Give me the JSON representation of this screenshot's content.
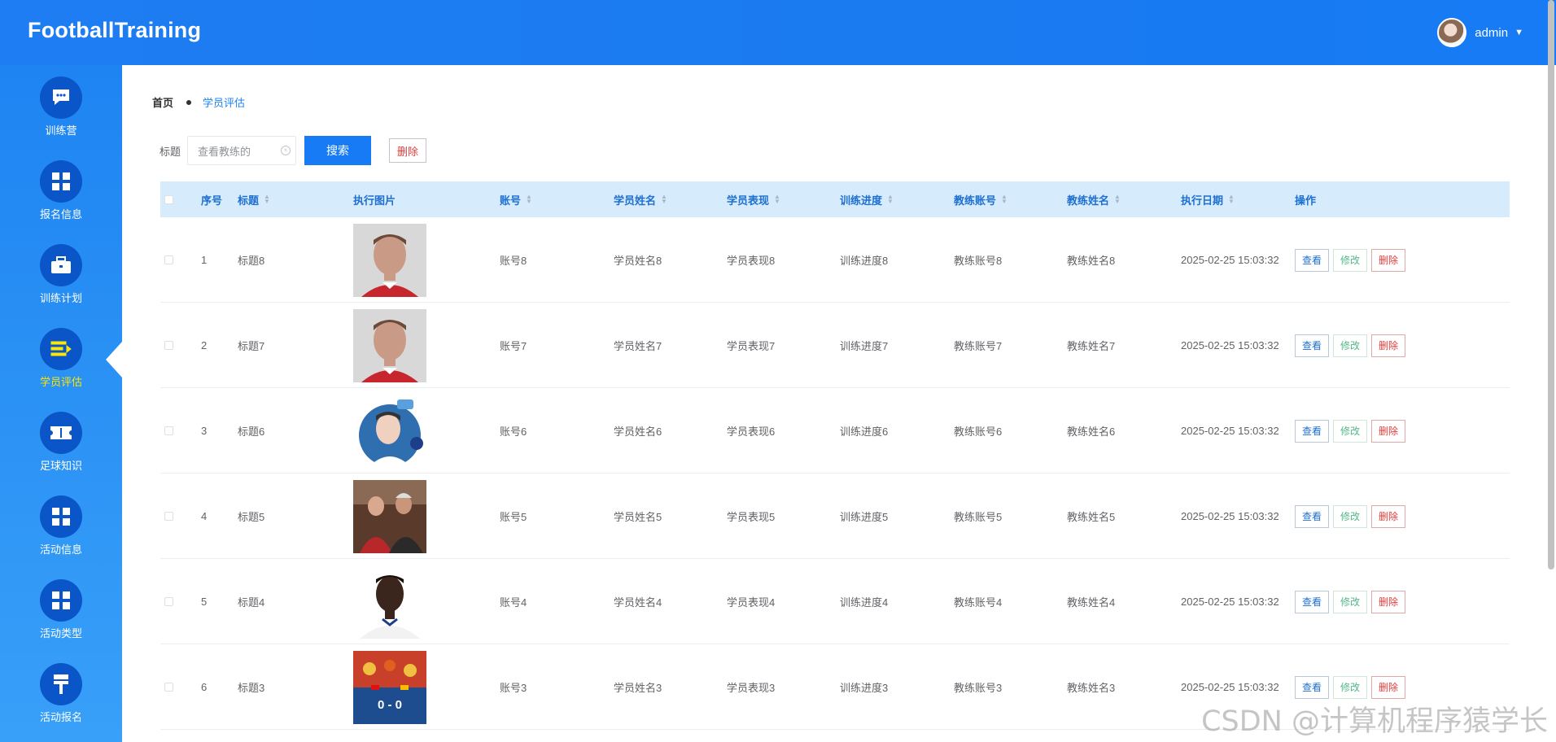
{
  "header": {
    "brand": "FootballTraining",
    "user": "admin"
  },
  "sidebar": {
    "items": [
      {
        "label": "训练营",
        "icon": "chat-icon"
      },
      {
        "label": "报名信息",
        "icon": "grid-icon"
      },
      {
        "label": "训练计划",
        "icon": "briefcase-icon"
      },
      {
        "label": "学员评估",
        "icon": "list-icon",
        "active": true
      },
      {
        "label": "足球知识",
        "icon": "ticket-icon"
      },
      {
        "label": "活动信息",
        "icon": "grid-icon"
      },
      {
        "label": "活动类型",
        "icon": "grid-icon"
      },
      {
        "label": "活动报名",
        "icon": "pin-icon"
      }
    ]
  },
  "breadcrumb": {
    "home": "首页",
    "current": "学员评估"
  },
  "search": {
    "label": "标题",
    "placeholder": "查看教练的",
    "search_button": "搜索",
    "delete_button": "删除"
  },
  "table": {
    "headers": [
      "序号",
      "标题",
      "执行图片",
      "账号",
      "学员姓名",
      "学员表现",
      "训练进度",
      "教练账号",
      "教练姓名",
      "执行日期",
      "操作"
    ],
    "rows": [
      {
        "index": "1",
        "title": "标题8",
        "account": "账号8",
        "student": "学员姓名8",
        "performance": "学员表现8",
        "progress": "训练进度8",
        "coach_account": "教练账号8",
        "coach_name": "教练姓名8",
        "date": "2025-02-25 15:03:32",
        "photo": "player-portrait-a"
      },
      {
        "index": "2",
        "title": "标题7",
        "account": "账号7",
        "student": "学员姓名7",
        "performance": "学员表现7",
        "progress": "训练进度7",
        "coach_account": "教练账号7",
        "coach_name": "教练姓名7",
        "date": "2025-02-25 15:03:32",
        "photo": "player-portrait-a"
      },
      {
        "index": "3",
        "title": "标题6",
        "account": "账号6",
        "student": "学员姓名6",
        "performance": "学员表现6",
        "progress": "训练进度6",
        "coach_account": "教练账号6",
        "coach_name": "教练姓名6",
        "date": "2025-02-25 15:03:32",
        "photo": "player-illustration"
      },
      {
        "index": "4",
        "title": "标题5",
        "account": "账号5",
        "student": "学员姓名5",
        "performance": "学员表现5",
        "progress": "训练进度5",
        "coach_account": "教练账号5",
        "coach_name": "教练姓名5",
        "date": "2025-02-25 15:03:32",
        "photo": "group-photo"
      },
      {
        "index": "5",
        "title": "标题4",
        "account": "账号4",
        "student": "学员姓名4",
        "performance": "学员表现4",
        "progress": "训练进度4",
        "coach_account": "教练账号4",
        "coach_name": "教练姓名4",
        "date": "2025-02-25 15:03:32",
        "photo": "player-portrait-b"
      },
      {
        "index": "6",
        "title": "标题3",
        "account": "账号3",
        "student": "学员姓名3",
        "performance": "学员表现3",
        "progress": "训练进度3",
        "coach_account": "教练账号3",
        "coach_name": "教练姓名3",
        "date": "2025-02-25 15:03:32",
        "photo": "scoreboard",
        "photo_text": "0 - 0"
      }
    ],
    "ops": {
      "view": "查看",
      "edit": "修改",
      "delete": "删除"
    }
  },
  "watermark": "CSDN @计算机程序猿学长",
  "colors": {
    "primary": "#167bf5",
    "active": "#ffe600",
    "danger": "#e03c3c",
    "success": "#52b788"
  }
}
